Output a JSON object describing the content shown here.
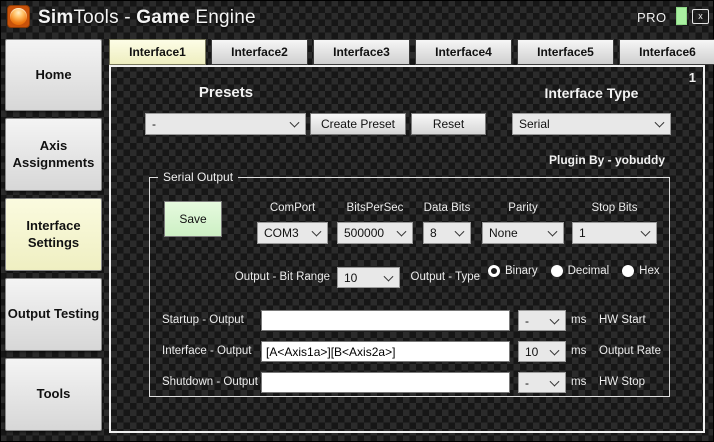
{
  "titlebar": {
    "title_parts": {
      "bold1": "Sim",
      "normal1": "Tools - ",
      "bold2": "Game",
      "normal2": " Engine"
    },
    "pro_label": "PRO",
    "close_label": "x"
  },
  "sidebar": {
    "items": [
      {
        "label": "Home",
        "active": false
      },
      {
        "label": "Axis Assignments",
        "active": false
      },
      {
        "label": "Interface Settings",
        "active": true
      },
      {
        "label": "Output Testing",
        "active": false
      },
      {
        "label": "Tools",
        "active": false
      }
    ]
  },
  "tabs": [
    {
      "label": "Interface1",
      "active": true
    },
    {
      "label": "Interface2",
      "active": false
    },
    {
      "label": "Interface3",
      "active": false
    },
    {
      "label": "Interface4",
      "active": false
    },
    {
      "label": "Interface5",
      "active": false
    },
    {
      "label": "Interface6",
      "active": false
    }
  ],
  "panel": {
    "page_number": "1",
    "presets": {
      "heading": "Presets",
      "dropdown_value": "-",
      "create_button": "Create Preset",
      "reset_button": "Reset"
    },
    "interface_type": {
      "heading": "Interface Type",
      "value": "Serial"
    },
    "plugin_by": "Plugin By - yobuddy",
    "serial_output": {
      "group_label": "Serial Output",
      "save_button": "Save",
      "comport": {
        "label": "ComPort",
        "value": "COM3"
      },
      "bitspersec": {
        "label": "BitsPerSec",
        "value": "500000"
      },
      "data_bits": {
        "label": "Data Bits",
        "value": "8"
      },
      "parity": {
        "label": "Parity",
        "value": "None"
      },
      "stop_bits": {
        "label": "Stop Bits",
        "value": "1"
      },
      "bit_range": {
        "label": "Output - Bit Range",
        "value": "10"
      },
      "output_type": {
        "label": "Output - Type",
        "options": [
          {
            "label": "Binary",
            "selected": true
          },
          {
            "label": "Decimal",
            "selected": false
          },
          {
            "label": "Hex",
            "selected": false
          }
        ]
      },
      "rows": [
        {
          "label": "Startup - Output",
          "value": "",
          "delay": "-",
          "unit": "ms",
          "suffix": "HW Start"
        },
        {
          "label": "Interface - Output",
          "value": "[A<Axis1a>][B<Axis2a>]",
          "delay": "10",
          "unit": "ms",
          "suffix": "Output Rate"
        },
        {
          "label": "Shutdown - Output",
          "value": "",
          "delay": "-",
          "unit": "ms",
          "suffix": "HW Stop"
        }
      ]
    }
  },
  "colors": {
    "active_highlight": "#f3f2c4",
    "save_green": "#d6f2cc",
    "toggle_green": "#a9f0a1",
    "panel_border": "#f1f1f1",
    "background_dark": "#1f1f1f"
  }
}
